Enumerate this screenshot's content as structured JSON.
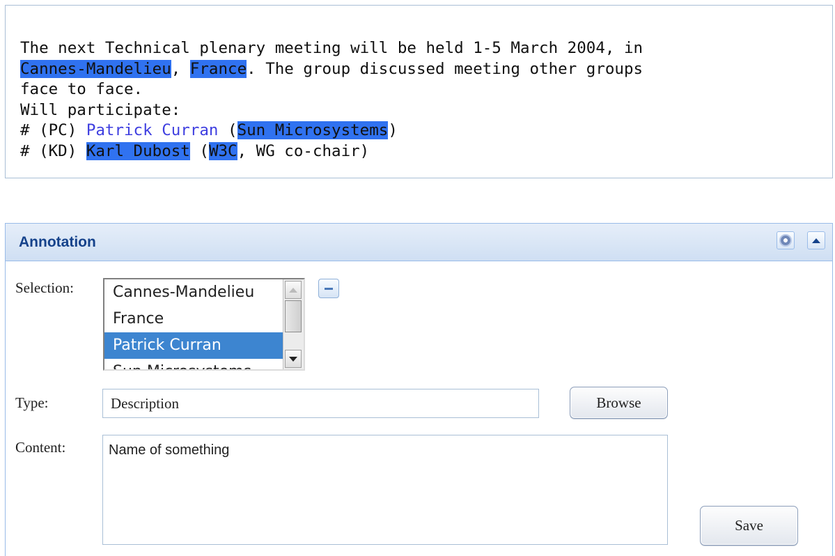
{
  "document_text": {
    "line1": "The next Technical plenary meeting will be held 1-5 March 2004, in",
    "line2_hl1": "Cannes-Mandelieu",
    "line2_sep": ", ",
    "line2_hl2": "France",
    "line2_rest": ". The group discussed meeting other groups",
    "line3": "face to face.",
    "line4": "Will participate:",
    "line5_prefix": "# (PC) ",
    "line5_link": "Patrick Curran",
    "line5_open": " (",
    "line5_hl": "Sun Microsystems",
    "line5_close": ")",
    "line6_prefix": "# (KD) ",
    "line6_hl1": "Karl Dubost",
    "line6_open": " (",
    "line6_hl2": "W3C",
    "line6_rest": ", WG co-chair)"
  },
  "colors": {
    "highlight": "#3072f0",
    "link": "#3f3fe0",
    "panel_title": "#15428b",
    "selected_item": "#3d85d0"
  },
  "annotation_panel": {
    "title": "Annotation",
    "tools": [
      "gear-icon",
      "collapse-up-icon"
    ]
  },
  "form": {
    "selection_label": "Selection:",
    "selection_items": [
      "Cannes-Mandelieu",
      "France",
      "Patrick Curran",
      "Sun Microsystems"
    ],
    "selected_item": "Patrick Curran",
    "type_label": "Type:",
    "type_value": "Description",
    "browse_label": "Browse",
    "content_label": "Content:",
    "content_value": "Name of something",
    "save_label": "Save"
  }
}
